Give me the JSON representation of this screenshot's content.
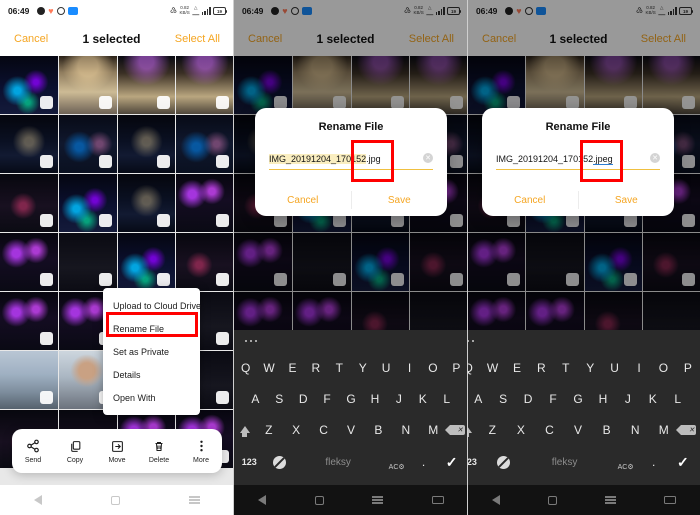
{
  "status_bar": {
    "time": "06:49",
    "left_icons": [
      "skull-icon",
      "heart-icon",
      "dnd-icon",
      "cloud-icon"
    ],
    "right_icons": [
      "mute-icon",
      "network-speed-icon",
      "wifi-signal-icon",
      "cellular-bars-icon",
      "battery-icon"
    ],
    "speed_up": "0.82",
    "speed_down": "KB/S",
    "battery_level": "19"
  },
  "app_bar": {
    "cancel": "Cancel",
    "title": "1 selected",
    "select_all": "Select All"
  },
  "context_menu": {
    "items": [
      {
        "label": "Upload to Cloud Drive",
        "highlighted": false
      },
      {
        "label": "Rename File",
        "highlighted": true
      },
      {
        "label": "Set as Private",
        "highlighted": false
      },
      {
        "label": "Details",
        "highlighted": false
      },
      {
        "label": "Open With",
        "highlighted": false
      }
    ]
  },
  "action_bar": {
    "items": [
      {
        "label": "Send",
        "icon": "share-icon"
      },
      {
        "label": "Copy",
        "icon": "copy-icon"
      },
      {
        "label": "Move",
        "icon": "move-icon"
      },
      {
        "label": "Delete",
        "icon": "trash-icon"
      },
      {
        "label": "More",
        "icon": "more-vertical-icon"
      }
    ]
  },
  "dialog_before": {
    "title": "Rename File",
    "filename_base": "IMG_20191204_170152",
    "filename_ext": ".jpg",
    "cancel": "Cancel",
    "save": "Save",
    "clear_icon": "clear-x-icon"
  },
  "dialog_after": {
    "title": "Rename File",
    "filename_base": "IMG_20191204_170152",
    "filename_ext": ".jpeg",
    "cancel": "Cancel",
    "save": "Save",
    "clear_icon": "clear-x-icon"
  },
  "keyboard": {
    "row1": [
      "Q",
      "W",
      "E",
      "R",
      "T",
      "Y",
      "U",
      "I",
      "O",
      "P"
    ],
    "row2": [
      "A",
      "S",
      "D",
      "F",
      "G",
      "H",
      "J",
      "K",
      "L"
    ],
    "row3": [
      "Z",
      "X",
      "C",
      "V",
      "B",
      "N",
      "M"
    ],
    "numeric_key": "123",
    "numeric_key_clipped": "23",
    "space_label": "fleksy",
    "autocorrect_label": "AC",
    "period_key": ".",
    "enter_icon": "checkmark-icon",
    "shift_icon": "shift-icon",
    "backspace_icon": "backspace-icon",
    "emoji_icon": "emoji-off-icon"
  },
  "nav_bar": {
    "back": "back-icon",
    "home": "home-icon",
    "recents": "recents-icon",
    "keyboard": "keyboard-icon"
  },
  "photo_grid": {
    "cells": [
      "ph-fountain",
      "ph-mosque",
      "ph-mosque2",
      "ph-mosque2",
      "ph-mbs",
      "ph-mbs2",
      "ph-mbs",
      "ph-mbs2",
      "ph-night",
      "ph-fountain",
      "ph-mbs",
      "ph-tree",
      "ph-tree",
      "ph-dark",
      "ph-fountain",
      "ph-night",
      "ph-tree",
      "ph-tree",
      "ph-night",
      "ph-dark",
      "ph-mlion",
      "ph-self",
      "ph-night",
      "ph-dark",
      "ph-night",
      "ph-night",
      "ph-tree",
      "ph-tree"
    ]
  },
  "colors": {
    "accent": "#f5a623",
    "annotation": "#ff0000",
    "highlight": "#faeec0",
    "keyboard_bg": "#2a2a2a"
  }
}
